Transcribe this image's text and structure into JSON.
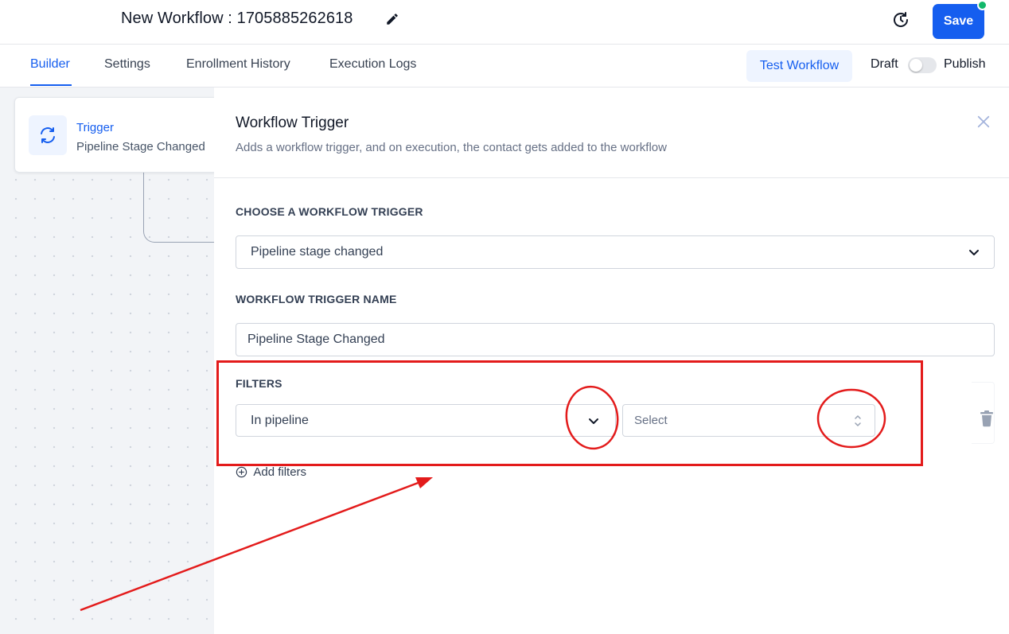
{
  "header": {
    "title": "New Workflow : 1705885262618",
    "save_label": "Save"
  },
  "tabs": [
    {
      "label": "Builder",
      "active": true
    },
    {
      "label": "Settings",
      "active": false
    },
    {
      "label": "Enrollment History",
      "active": false
    },
    {
      "label": "Execution Logs",
      "active": false
    }
  ],
  "toolbar": {
    "test_label": "Test Workflow",
    "draft_label": "Draft",
    "publish_label": "Publish",
    "published": false
  },
  "canvas": {
    "trigger_node": {
      "title": "Trigger",
      "subtitle": "Pipeline Stage Changed",
      "icon": "refresh-icon"
    }
  },
  "panel": {
    "title": "Workflow Trigger",
    "description": "Adds a workflow trigger, and on execution, the contact gets added to the workflow",
    "choose_label": "CHOOSE A WORKFLOW TRIGGER",
    "trigger_value": "Pipeline stage changed",
    "name_label": "WORKFLOW TRIGGER NAME",
    "name_value": "Pipeline Stage Changed",
    "filters_label": "FILTERS",
    "filter_field": "In pipeline",
    "filter_value_placeholder": "Select",
    "add_filters_label": "Add filters"
  },
  "colors": {
    "accent": "#155eef",
    "status_dot": "#12b76a",
    "annotation": "#e31b1b"
  }
}
